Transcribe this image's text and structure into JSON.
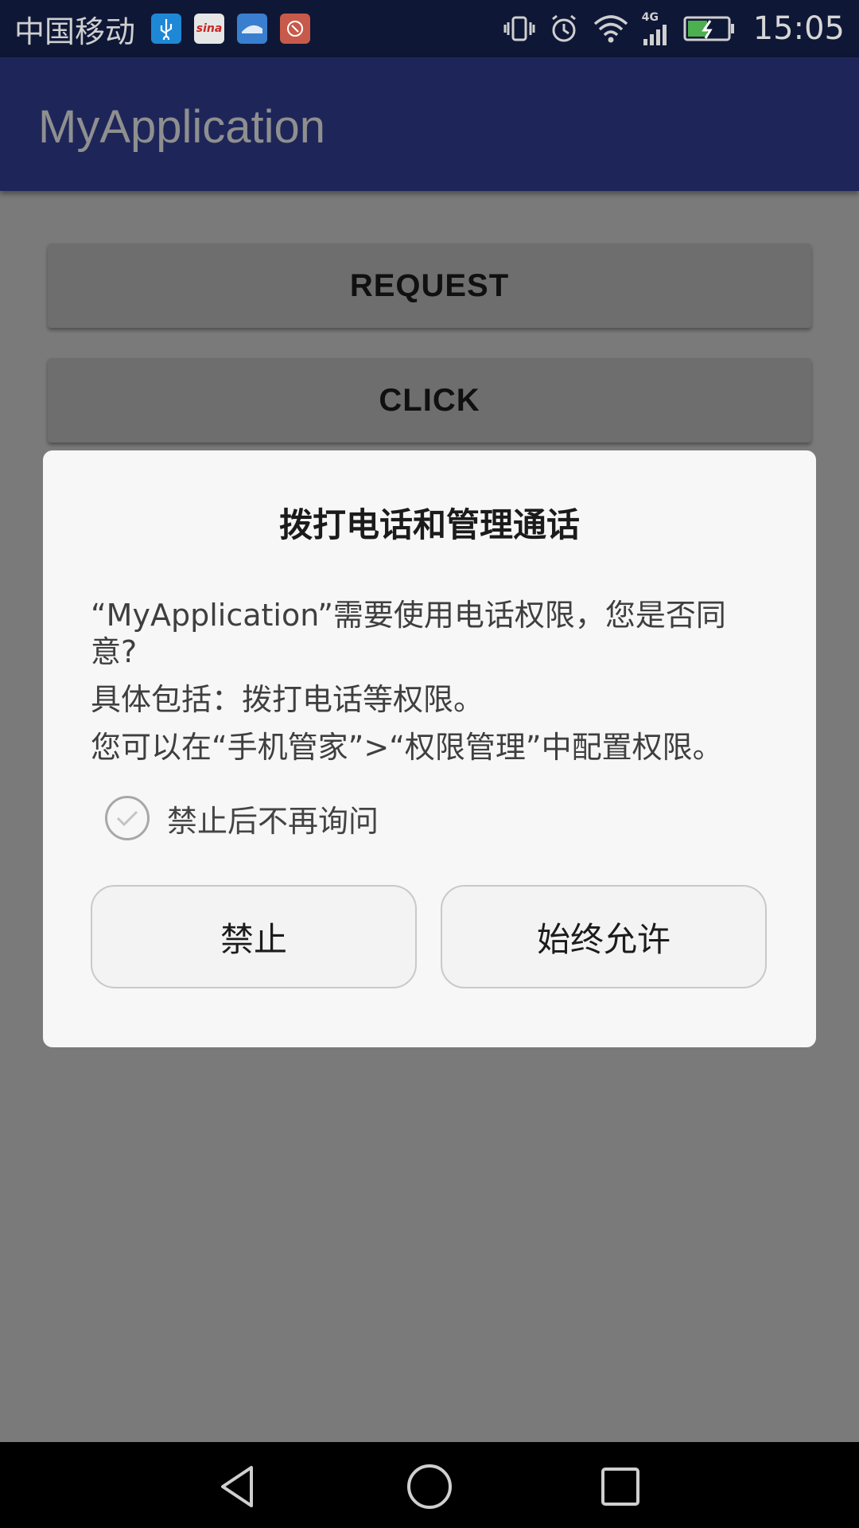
{
  "status_bar": {
    "carrier": "中国移动",
    "network_type": "4G",
    "time": "15:05",
    "notification_icons": [
      "usb-icon",
      "sina-icon",
      "app-icon",
      "red-app-icon"
    ],
    "sina_label": "sina"
  },
  "app_bar": {
    "title": "MyApplication"
  },
  "content": {
    "request_button": "REQUEST",
    "click_button": "CLICK"
  },
  "dialog": {
    "title": "拨打电话和管理通话",
    "body_line1": "“MyApplication”需要使用电话权限，您是否同意?",
    "body_line2": "具体包括：拨打电话等权限。",
    "body_line3": "您可以在“手机管家”>“权限管理”中配置权限。",
    "checkbox_label": "禁止后不再询问",
    "checkbox_checked": false,
    "deny_button": "禁止",
    "allow_button": "始终允许"
  },
  "colors": {
    "status_bar_bg": "#0f1736",
    "app_bar_bg": "#1e2659",
    "scrim": "#7a7a7a",
    "dialog_bg": "#f7f7f7"
  }
}
